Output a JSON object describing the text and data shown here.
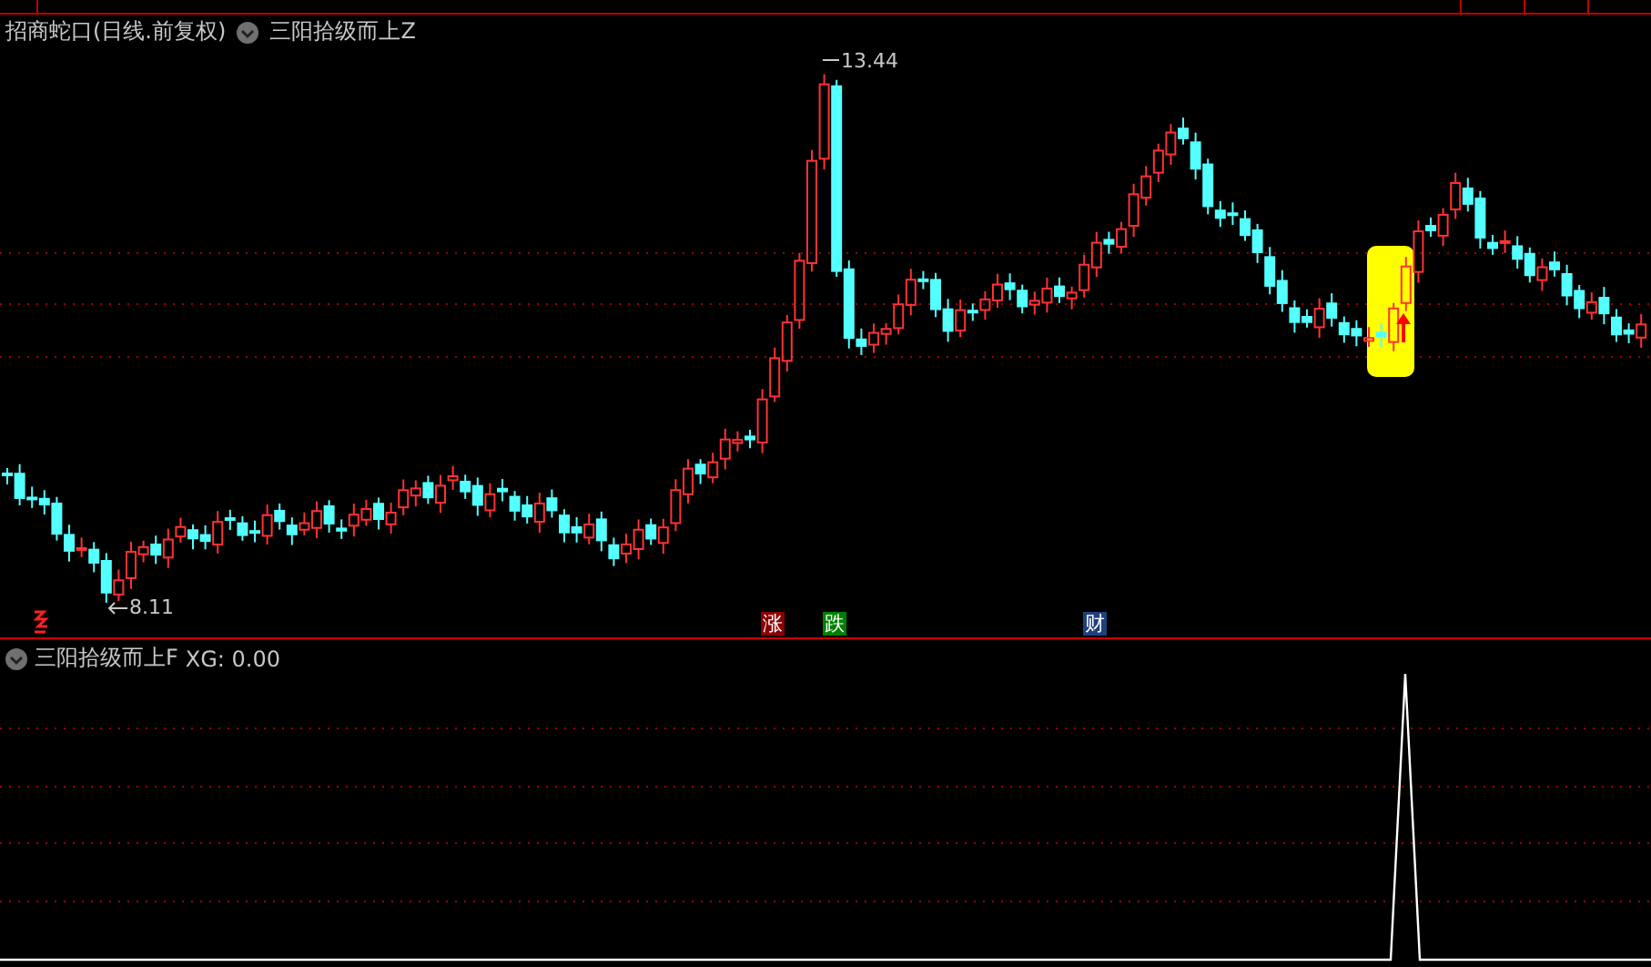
{
  "main_pane": {
    "stock_title": "招商蛇口(日线.前复权)",
    "formula": "三阳拾级而上Z",
    "high_label": "13.44",
    "low_label": "8.11",
    "events": [
      {
        "text": "涨",
        "color": "#8b0000"
      },
      {
        "text": "跌",
        "color": "#008000"
      },
      {
        "text": "财",
        "color": "#1f3f7f"
      }
    ]
  },
  "indicator_pane": {
    "formula": "三阳拾级而上F",
    "reading": "XG: 0.00"
  }
}
